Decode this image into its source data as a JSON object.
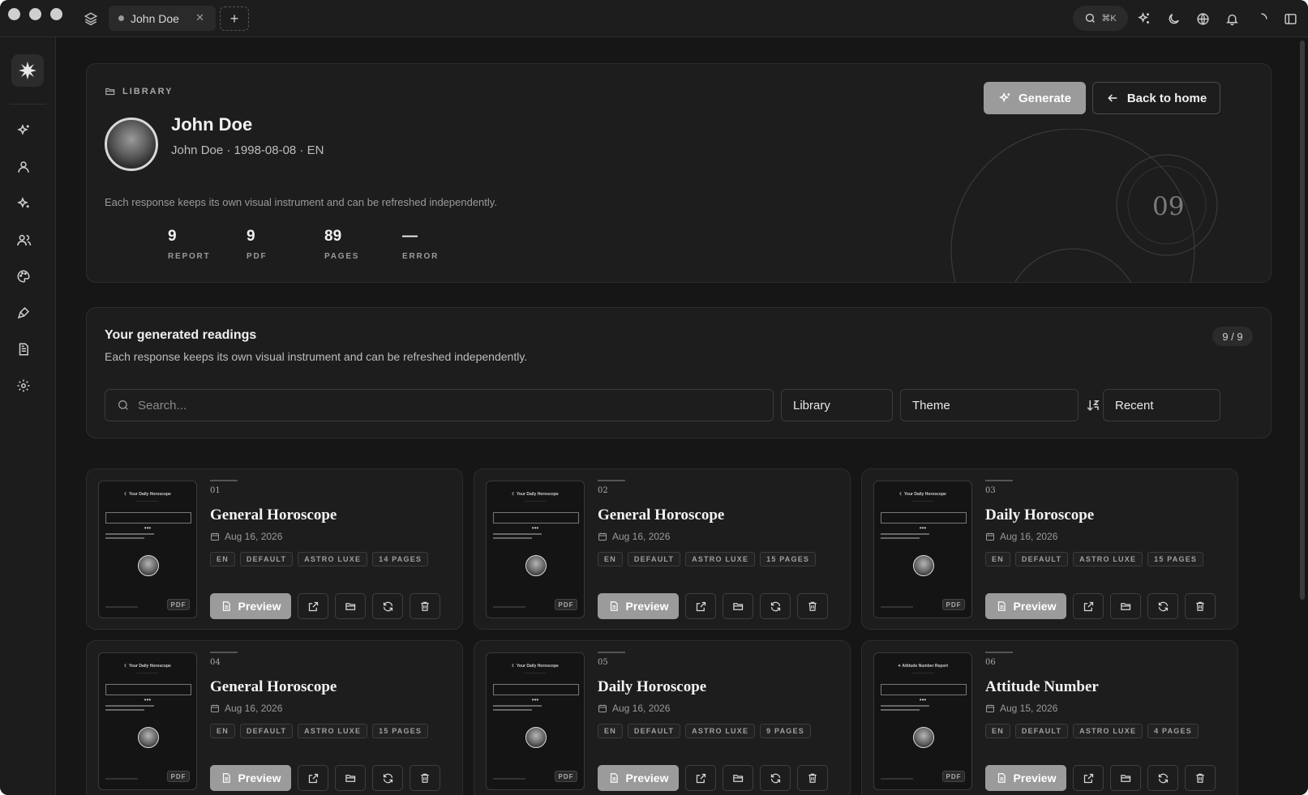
{
  "tab": {
    "label": "John Doe"
  },
  "titlebar": {
    "search_shortcut": "⌘K"
  },
  "hero": {
    "eyebrow": "LIBRARY",
    "name": "John Doe",
    "subtitle": "John Doe · 1998-08-08 · EN",
    "description": "Each response keeps its own visual instrument and can be refreshed independently.",
    "stats": [
      {
        "value": "9",
        "label": "REPORT"
      },
      {
        "value": "9",
        "label": "PDF"
      },
      {
        "value": "89",
        "label": "PAGES"
      },
      {
        "value": "—",
        "label": "ERROR"
      }
    ],
    "generate_label": "Generate",
    "back_label": "Back to home",
    "deco_number": "09"
  },
  "readings": {
    "title": "Your generated readings",
    "description": "Each response keeps its own visual instrument and can be refreshed independently.",
    "count": "9 / 9",
    "search_placeholder": "Search...",
    "filter_library": "Library",
    "filter_theme": "Theme",
    "sort": "Recent"
  },
  "cards": [
    {
      "num": "01",
      "title": "General Horoscope",
      "date": "Aug 16, 2026",
      "tags": [
        "EN",
        "DEFAULT",
        "ASTRO LUXE",
        "14 PAGES"
      ],
      "thumb_title": "☾ Your Daily Horoscope",
      "badge": "PDF",
      "preview": "Preview"
    },
    {
      "num": "02",
      "title": "General Horoscope",
      "date": "Aug 16, 2026",
      "tags": [
        "EN",
        "DEFAULT",
        "ASTRO LUXE",
        "15 PAGES"
      ],
      "thumb_title": "☾ Your Daily Horoscope",
      "badge": "PDF",
      "preview": "Preview"
    },
    {
      "num": "03",
      "title": "Daily Horoscope",
      "date": "Aug 16, 2026",
      "tags": [
        "EN",
        "DEFAULT",
        "ASTRO LUXE",
        "15 PAGES"
      ],
      "thumb_title": "☾ Your Daily Horoscope",
      "badge": "PDF",
      "preview": "Preview"
    },
    {
      "num": "04",
      "title": "General Horoscope",
      "date": "Aug 16, 2026",
      "tags": [
        "EN",
        "DEFAULT",
        "ASTRO LUXE",
        "15 PAGES"
      ],
      "thumb_title": "☾ Your Daily Horoscope",
      "badge": "PDF",
      "preview": "Preview"
    },
    {
      "num": "05",
      "title": "Daily Horoscope",
      "date": "Aug 16, 2026",
      "tags": [
        "EN",
        "DEFAULT",
        "ASTRO LUXE",
        "9 PAGES"
      ],
      "thumb_title": "☾ Your Daily Horoscope",
      "badge": "PDF",
      "preview": "Preview"
    },
    {
      "num": "06",
      "title": "Attitude Number",
      "date": "Aug 15, 2026",
      "tags": [
        "EN",
        "DEFAULT",
        "ASTRO LUXE",
        "4 PAGES"
      ],
      "thumb_title": "✦ Attitude Number Report",
      "badge": "PDF",
      "preview": "Preview"
    }
  ]
}
